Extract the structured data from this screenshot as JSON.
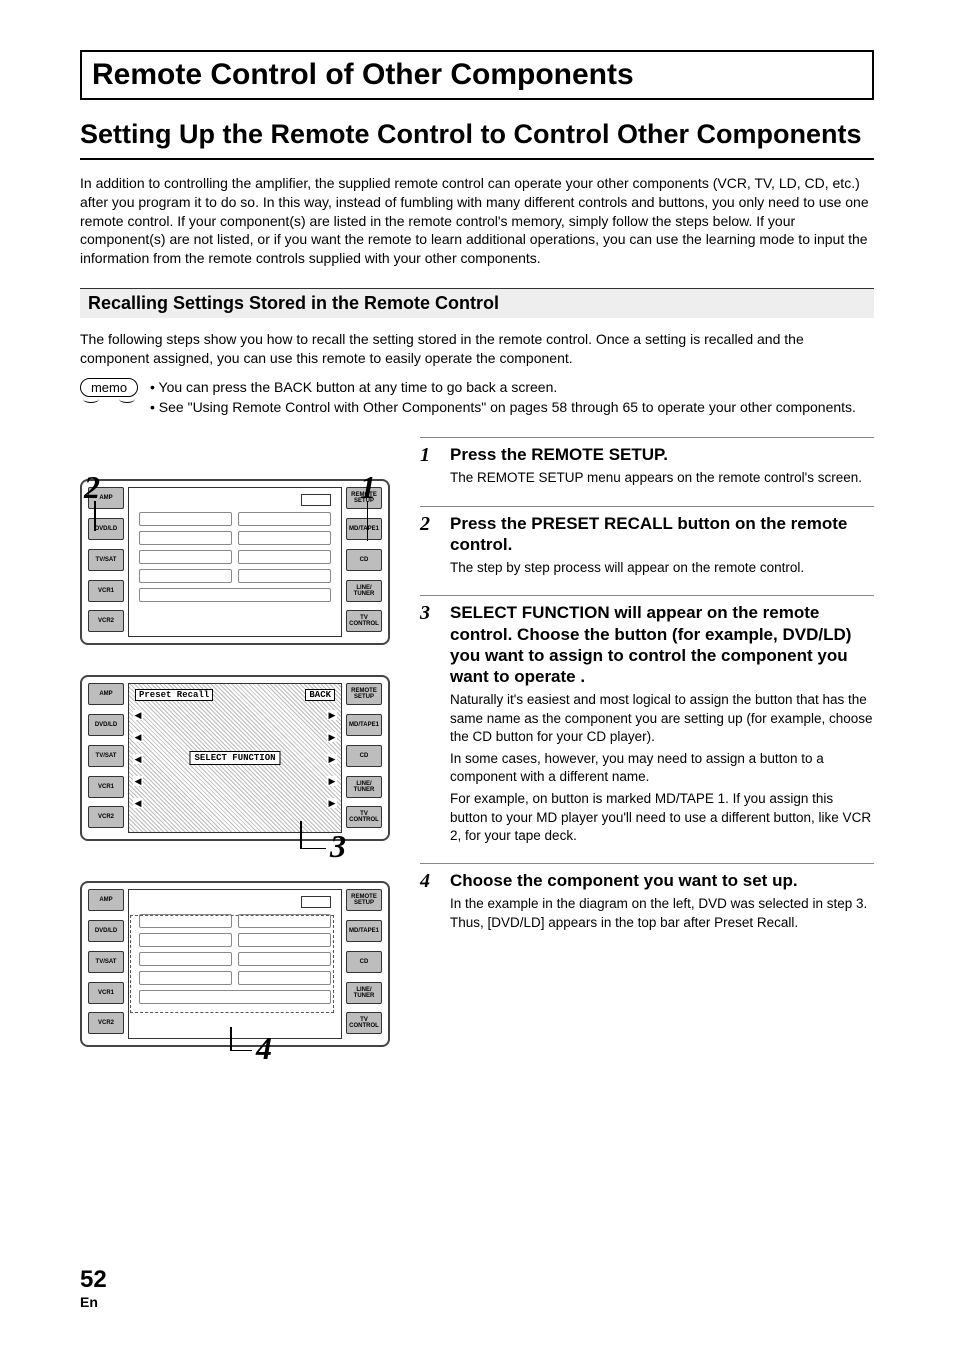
{
  "page_title": "Remote Control of Other Components",
  "section_title": "Setting Up the Remote Control to Control Other Components",
  "intro": "In addition to controlling the amplifier, the supplied remote control can operate your other components (VCR, TV, LD, CD, etc.) after you program it to do so. In this way, instead of fumbling with many different controls and buttons, you only need to use one remote control. If your component(s) are listed in the remote control's memory, simply follow the steps below. If your component(s) are not listed, or if you want the remote to learn additional operations, you can use the learning mode to input the information from the remote controls supplied with your other components.",
  "sub_heading": "Recalling Settings Stored in the Remote Control",
  "recall_para": "The following steps show you how to recall the setting stored in the remote control. Once a setting is recalled and the component assigned, you can use this remote to easily operate the component.",
  "memo_label": "memo",
  "memo_items": [
    "You can press the BACK button at any time to go back a screen.",
    "See \"Using Remote Control with Other Components\" on pages 58 through 65 to operate your other components."
  ],
  "remote_left_buttons": [
    "AMP",
    "DVD/LD",
    "TV/SAT",
    "VCR1",
    "VCR2"
  ],
  "remote_right_buttons": [
    "REMOTE SETUP",
    "MD/TAPE1",
    "CD",
    "LINE/ TUNER",
    "TV CONTROL"
  ],
  "screen2_header": "Preset Recall",
  "screen2_back": "BACK",
  "screen2_center": "SELECT FUNCTION",
  "callout_1": "1",
  "callout_2": "2",
  "callout_3": "3",
  "callout_4": "4",
  "steps": [
    {
      "num": "1",
      "title": "Press the REMOTE SETUP.",
      "body": [
        "The REMOTE SETUP menu appears on the remote control's screen."
      ]
    },
    {
      "num": "2",
      "title": "Press the PRESET RECALL button on the remote control.",
      "body": [
        "The step by step process will appear on the remote control."
      ]
    },
    {
      "num": "3",
      "title": "SELECT FUNCTION will appear on the remote control. Choose the button (for example, DVD/LD) you want to assign to control the component you want to operate .",
      "body": [
        "Naturally it's easiest and most logical to assign the button that has the same name as the component you are setting up (for example, choose the CD button for your CD player).",
        "In some cases, however, you may need to assign a button to a component with a different name.",
        "For example, on button is marked MD/TAPE 1. If you assign this button to your MD player you'll need to use a different button, like VCR 2,  for your tape deck."
      ]
    },
    {
      "num": "4",
      "title": "Choose the component you want to set up.",
      "body": [
        "In the example in the diagram on the left, DVD was selected in step 3. Thus, [DVD/LD] appears in the top bar after Preset Recall."
      ]
    }
  ],
  "page_number": "52",
  "page_lang": "En"
}
